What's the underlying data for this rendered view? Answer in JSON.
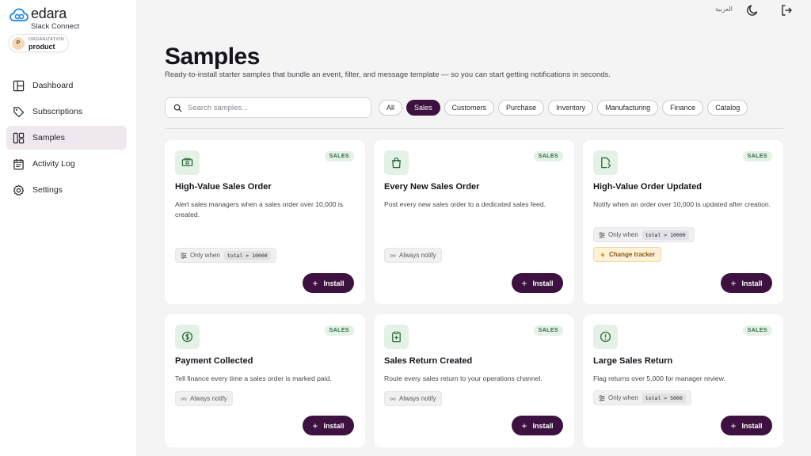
{
  "brand": {
    "name": "edara",
    "subtitle": "Slack Connect"
  },
  "org": {
    "caption": "ORGANIZATION",
    "name": "product",
    "initial": "P"
  },
  "nav": [
    {
      "label": "Dashboard",
      "icon": "dashboard-icon"
    },
    {
      "label": "Subscriptions",
      "icon": "tag-icon"
    },
    {
      "label": "Samples",
      "icon": "samples-icon",
      "active": true
    },
    {
      "label": "Activity Log",
      "icon": "calendar-icon"
    },
    {
      "label": "Settings",
      "icon": "gear-icon"
    }
  ],
  "topbar": {
    "language": "العربية"
  },
  "page": {
    "title": "Samples",
    "subtitle": "Ready-to-install starter samples that bundle an event, filter, and message template — so you can start getting notifications in seconds."
  },
  "search": {
    "placeholder": "Search samples..."
  },
  "filters": [
    "All",
    "Sales",
    "Customers",
    "Purchase",
    "Inventory",
    "Manufacturing",
    "Finance",
    "Catalog"
  ],
  "active_filter": "Sales",
  "install_label": "Install",
  "cards": [
    {
      "badge": "SALES",
      "title": "High-Value Sales Order",
      "desc": "Alert sales managers when a sales order over 10,000 is created.",
      "condition": {
        "type": "only_when",
        "label": "Only when",
        "code": "total > 10000"
      },
      "icon": "money-icon"
    },
    {
      "badge": "SALES",
      "title": "Every New Sales Order",
      "desc": "Post every new sales order to a dedicated sales feed.",
      "condition": {
        "type": "always",
        "label": "Always notify"
      },
      "icon": "shopping-bag-icon"
    },
    {
      "badge": "SALES",
      "title": "High-Value Order Updated",
      "desc": "Notify when an order over 10,000 is updated after creation.",
      "condition": {
        "type": "only_when",
        "label": "Only when",
        "code": "total > 10000"
      },
      "extra": "Change tracker",
      "icon": "document-edit-icon"
    },
    {
      "badge": "SALES",
      "title": "Payment Collected",
      "desc": "Tell finance every time a sales order is marked paid.",
      "condition": {
        "type": "always",
        "label": "Always notify"
      },
      "icon": "dollar-circle-icon"
    },
    {
      "badge": "SALES",
      "title": "Sales Return Created",
      "desc": "Route every sales return to your operations channel.",
      "condition": {
        "type": "always",
        "label": "Always notify"
      },
      "icon": "clipboard-plus-icon"
    },
    {
      "badge": "SALES",
      "title": "Large Sales Return",
      "desc": "Flag returns over 5,000 for manager review.",
      "condition": {
        "type": "only_when",
        "label": "Only when",
        "code": "total > 5000"
      },
      "icon": "alert-circle-icon"
    }
  ]
}
